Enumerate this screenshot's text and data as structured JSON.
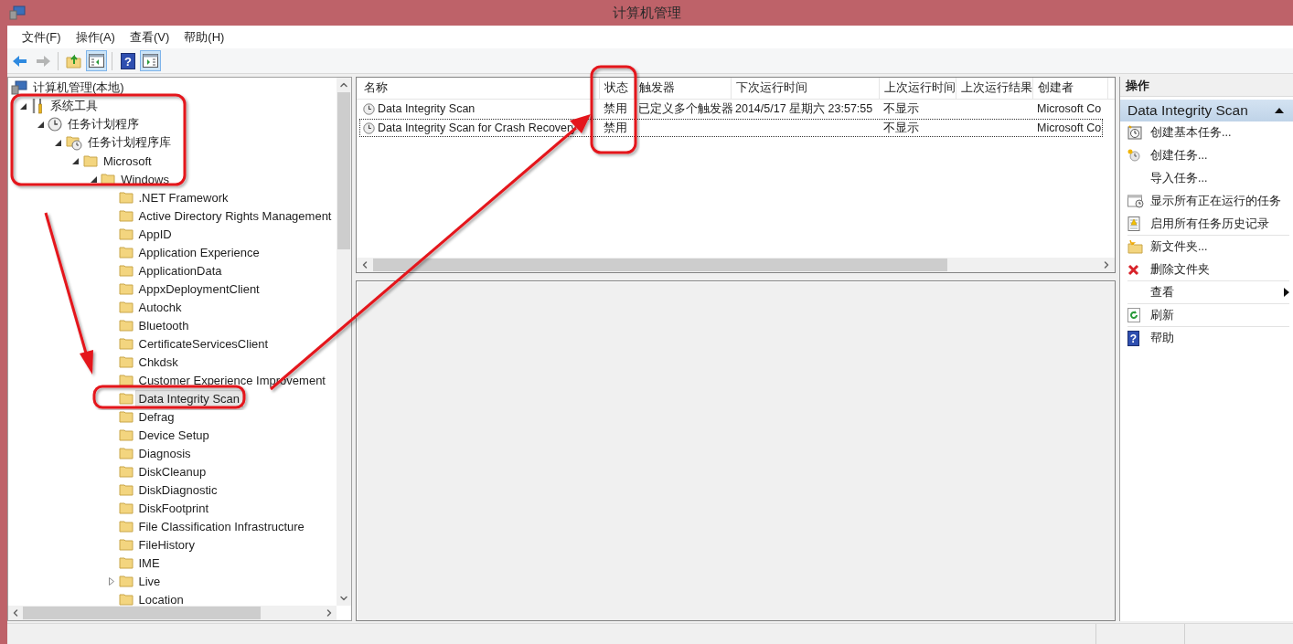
{
  "window": {
    "title": "计算机管理"
  },
  "menu": [
    {
      "label": "文件(F)"
    },
    {
      "label": "操作(A)"
    },
    {
      "label": "查看(V)"
    },
    {
      "label": "帮助(H)"
    }
  ],
  "toolbar": [
    {
      "kind": "back",
      "disabled": false,
      "pressed": false
    },
    {
      "kind": "forward",
      "disabled": true,
      "pressed": false
    },
    {
      "kind": "separator"
    },
    {
      "kind": "up",
      "disabled": false,
      "pressed": false
    },
    {
      "kind": "tree",
      "disabled": false,
      "pressed": true
    },
    {
      "kind": "separator"
    },
    {
      "kind": "help",
      "glyph": "?",
      "disabled": false,
      "pressed": false
    },
    {
      "kind": "actions",
      "disabled": false,
      "pressed": true
    }
  ],
  "tree": [
    {
      "label": "计算机管理(本地)",
      "selected": false,
      "children": [
        {
          "label": "系统工具",
          "expanded": true,
          "selected": false,
          "children": [
            {
              "label": "任务计划程序",
              "expanded": true,
              "selected": false,
              "children": [
                {
                  "label": "任务计划程序库",
                  "expanded": true,
                  "selected": false,
                  "children": [
                    {
                      "label": "Microsoft",
                      "expanded": true,
                      "selected": false,
                      "children": [
                        {
                          "label": "Windows",
                          "expanded": true,
                          "selected": false,
                          "children": [
                            {
                              "label": ".NET Framework",
                              "selected": false
                            },
                            {
                              "label": "Active Directory Rights Management",
                              "selected": false
                            },
                            {
                              "label": "AppID",
                              "selected": false
                            },
                            {
                              "label": "Application Experience",
                              "selected": false
                            },
                            {
                              "label": "ApplicationData",
                              "selected": false
                            },
                            {
                              "label": "AppxDeploymentClient",
                              "selected": false
                            },
                            {
                              "label": "Autochk",
                              "selected": false
                            },
                            {
                              "label": "Bluetooth",
                              "selected": false
                            },
                            {
                              "label": "CertificateServicesClient",
                              "selected": false
                            },
                            {
                              "label": "Chkdsk",
                              "selected": false
                            },
                            {
                              "label": "Customer Experience Improvement",
                              "selected": false
                            },
                            {
                              "label": "Data Integrity Scan",
                              "selected": true
                            },
                            {
                              "label": "Defrag",
                              "selected": false
                            },
                            {
                              "label": "Device Setup",
                              "selected": false
                            },
                            {
                              "label": "Diagnosis",
                              "selected": false
                            },
                            {
                              "label": "DiskCleanup",
                              "selected": false
                            },
                            {
                              "label": "DiskDiagnostic",
                              "selected": false
                            },
                            {
                              "label": "DiskFootprint",
                              "selected": false
                            },
                            {
                              "label": "File Classification Infrastructure",
                              "selected": false
                            },
                            {
                              "label": "FileHistory",
                              "selected": false
                            },
                            {
                              "label": "IME",
                              "selected": false
                            },
                            {
                              "label": "Live",
                              "expanded": false,
                              "selected": false
                            },
                            {
                              "label": "Location",
                              "selected": false
                            }
                          ]
                        }
                      ]
                    }
                  ]
                }
              ]
            }
          ]
        }
      ]
    }
  ],
  "table": {
    "columns": [
      "名称",
      "状态",
      "触发器",
      "下次运行时间",
      "上次运行时间",
      "上次运行结果",
      "创建者"
    ],
    "rows": [
      {
        "focused": false,
        "cells": [
          "Data Integrity Scan",
          "禁用",
          "已定义多个触发器",
          "2014/5/17 星期六 23:57:55",
          "不显示",
          "",
          "Microsoft Co"
        ]
      },
      {
        "focused": true,
        "cells": [
          "Data Integrity Scan for Crash Recovery",
          "禁用",
          "",
          "",
          "不显示",
          "",
          "Microsoft Co"
        ]
      }
    ]
  },
  "actions": {
    "title": "操作",
    "section": "Data Integrity Scan",
    "items": [
      {
        "label": "创建基本任务...",
        "separator_after": false,
        "submenu": false
      },
      {
        "label": "创建任务...",
        "separator_after": false,
        "submenu": false
      },
      {
        "label": "导入任务...",
        "separator_after": false,
        "submenu": false
      },
      {
        "label": "显示所有正在运行的任务",
        "separator_after": false,
        "submenu": false
      },
      {
        "label": "启用所有任务历史记录",
        "separator_after": true,
        "submenu": false
      },
      {
        "label": "新文件夹...",
        "separator_after": false,
        "submenu": false
      },
      {
        "label": "删除文件夹",
        "separator_after": true,
        "submenu": false
      },
      {
        "label": "查看",
        "separator_after": true,
        "submenu": true
      },
      {
        "label": "刷新",
        "separator_after": true,
        "submenu": false
      },
      {
        "label": "帮助",
        "icon_glyph": "?",
        "separator_after": false,
        "submenu": false
      }
    ]
  }
}
